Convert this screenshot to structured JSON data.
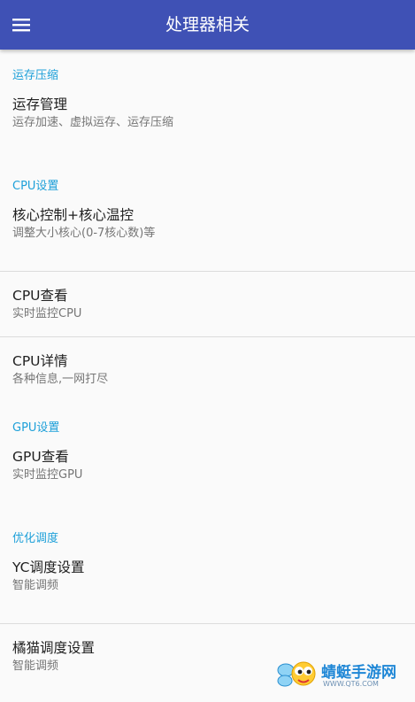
{
  "appbar": {
    "title": "处理器相关",
    "menu_icon": "hamburger-menu-icon"
  },
  "sections": [
    {
      "header": "运存压缩",
      "items": [
        {
          "title": "运存管理",
          "subtitle": "运存加速、虚拟运存、运存压缩"
        }
      ]
    },
    {
      "header": "CPU设置",
      "items": [
        {
          "title": "核心控制+核心温控",
          "subtitle": "调整大小核心(0-7核心数)等"
        },
        {
          "title": "CPU查看",
          "subtitle": "实时监控CPU"
        },
        {
          "title": "CPU详情",
          "subtitle": "各种信息,一网打尽"
        }
      ]
    },
    {
      "header": "GPU设置",
      "items": [
        {
          "title": "GPU查看",
          "subtitle": "实时监控GPU"
        }
      ]
    },
    {
      "header": "优化调度",
      "items": [
        {
          "title": "YC调度设置",
          "subtitle": "智能调频"
        },
        {
          "title": "橘猫调度设置",
          "subtitle": "智能调频"
        }
      ]
    }
  ],
  "watermark": {
    "name": "蜻蜓手游网",
    "url": "WWW.QT6.COM"
  },
  "colors": {
    "appbar": "#3f51b5",
    "section_header": "#1ea0d9",
    "background": "#fafafa",
    "divider": "#dcdcdc"
  }
}
